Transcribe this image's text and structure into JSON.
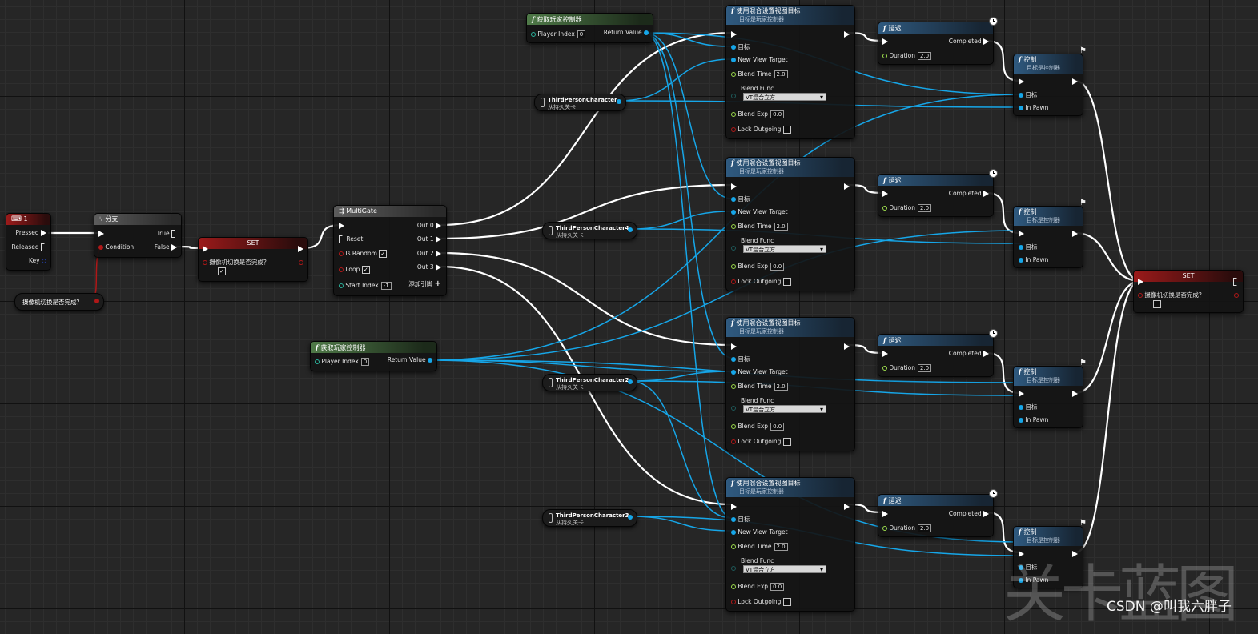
{
  "input_node": {
    "title": "1",
    "pins": [
      "Pressed",
      "Released",
      "Key"
    ]
  },
  "bool_get_var": {
    "label": "摄像机切换是否完成？"
  },
  "branch": {
    "title": "分支",
    "condition": "Condition",
    "true_label": "True",
    "false_label": "False"
  },
  "set_left": {
    "title": "SET",
    "var_label": "摄像机切换是否完成？",
    "checked": "✓"
  },
  "multigate": {
    "title": "MultiGate",
    "reset": "Reset",
    "is_random": "Is Random",
    "loop": "Loop",
    "start_index": "Start Index",
    "start_index_value": "-1",
    "outs": [
      "Out 0",
      "Out 1",
      "Out 2",
      "Out 3"
    ],
    "add_pin": "添加引脚",
    "checked": "✓"
  },
  "get_player_controller_top": {
    "title": "获取玩家控制器",
    "player_index": "Player Index",
    "index_value": "0",
    "return_value": "Return Value"
  },
  "get_player_controller_mid": {
    "title": "获取玩家控制器",
    "player_index": "Player Index",
    "index_value": "0",
    "return_value": "Return Value"
  },
  "vars": [
    {
      "name": "ThirdPersonCharacter",
      "sub": "从持久关卡"
    },
    {
      "name": "ThirdPersonCharacter4",
      "sub": "从持久关卡"
    },
    {
      "name": "ThirdPersonCharacter2",
      "sub": "从持久关卡"
    },
    {
      "name": "ThirdPersonCharacter3",
      "sub": "从持久关卡"
    }
  ],
  "blend_node": {
    "title": "使用混合设置视图目标",
    "subtitle": "目标是玩家控制器",
    "target": "目标",
    "new_view_target": "New View Target",
    "blend_time": "Blend Time",
    "blend_time_value": "2.0",
    "blend_func": "Blend Func",
    "blend_func_value": "VT混合立方",
    "blend_exp": "Blend Exp",
    "blend_exp_value": "0.0",
    "lock_outgoing": "Lock Outgoing"
  },
  "delay_node": {
    "title": "延迟",
    "completed": "Completed",
    "duration": "Duration",
    "duration_value": "2.0"
  },
  "possess_node": {
    "title": "控制",
    "subtitle": "目标是控制器",
    "target": "目标",
    "in_pawn": "In Pawn"
  },
  "set_right": {
    "title": "SET",
    "var_label": "摄像机切换是否完成？"
  },
  "watermark": "关卡蓝图",
  "credit": "CSDN @叫我六胖子",
  "colors": {
    "exec_wire": "#ffffff",
    "object_wire": "#16a6e8",
    "bool_pin": "#b01818",
    "float_pin": "#9cdc4c"
  }
}
